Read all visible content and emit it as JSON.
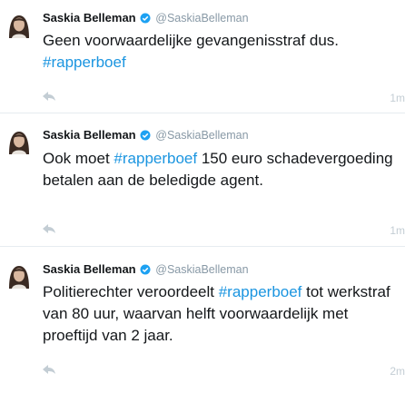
{
  "tweets": [
    {
      "name": "Saskia Belleman",
      "handle": "@SaskiaBelleman",
      "text_parts": [
        {
          "type": "text",
          "value": "Geen voorwaardelijke gevangenisstraf dus. "
        },
        {
          "type": "hashtag",
          "value": "#rapperboef"
        }
      ],
      "time": "1m"
    },
    {
      "name": "Saskia Belleman",
      "handle": "@SaskiaBelleman",
      "text_parts": [
        {
          "type": "text",
          "value": "Ook moet "
        },
        {
          "type": "hashtag",
          "value": "#rapperboef"
        },
        {
          "type": "text",
          "value": " 150 euro schadevergoeding betalen aan de beledigde agent."
        }
      ],
      "time": "1m"
    },
    {
      "name": "Saskia Belleman",
      "handle": "@SaskiaBelleman",
      "text_parts": [
        {
          "type": "text",
          "value": "Politierechter veroordeelt "
        },
        {
          "type": "hashtag",
          "value": "#rapperboef"
        },
        {
          "type": "text",
          "value": " tot werkstraf van 80 uur, waarvan helft voorwaardelijk met proeftijd van 2 jaar."
        }
      ],
      "time": "2m"
    }
  ],
  "icons": {
    "verified": "verified-badge-icon",
    "reply": "reply-icon"
  },
  "colors": {
    "hashtag": "#1b95e0",
    "handle": "#8899a6",
    "verified": "#1da1f2",
    "icon": "#c3cdd4"
  }
}
